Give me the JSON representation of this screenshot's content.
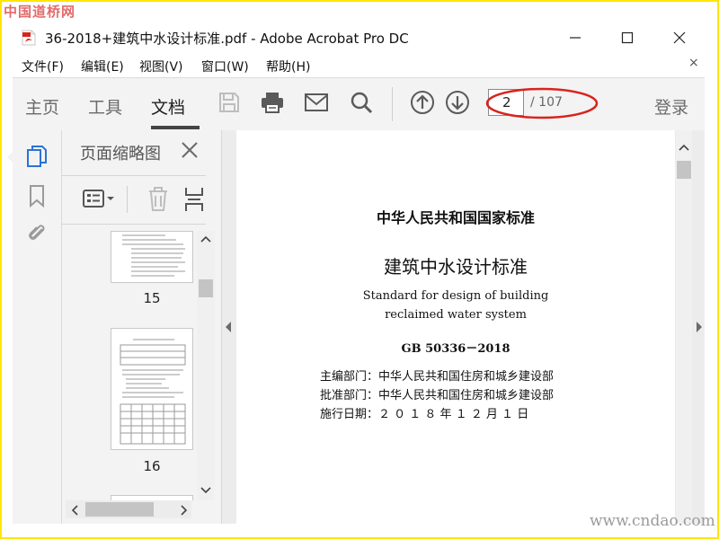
{
  "watermark_top": "中国道桥网",
  "watermark_bottom": "www.cndao.com",
  "window": {
    "title": "36-2018+建筑中水设计标准.pdf - Adobe Acrobat Pro DC"
  },
  "menu": {
    "items": [
      "文件(F)",
      "编辑(E)",
      "视图(V)",
      "窗口(W)",
      "帮助(H)"
    ],
    "close_glyph": "×"
  },
  "toolbar": {
    "tabs": [
      "主页",
      "工具",
      "文档"
    ],
    "active_tab": "文档",
    "icons": [
      "save-icon",
      "print-icon",
      "email-icon",
      "search-icon",
      "page-up-icon",
      "page-down-icon"
    ],
    "page_number": "2",
    "page_total": "/ 107",
    "login_label": "登录",
    "highlight_color": "#d9231d"
  },
  "left_rail": {
    "icons": [
      "page-thumbnails-icon",
      "bookmark-icon",
      "attachment-icon"
    ],
    "accent_color": "#2b72d6"
  },
  "thumbnail_panel": {
    "title": "页面缩略图",
    "thumbnails": [
      {
        "label": "15"
      },
      {
        "label": "16"
      }
    ]
  },
  "document": {
    "heading": "中华人民共和国国家标准",
    "title": "建筑中水设计标准",
    "english_title_line1": "Standard for design of building",
    "english_title_line2": "reclaimed water system",
    "code": "GB 50336－2018",
    "info": [
      "主编部门：中华人民共和国住房和城乡建设部",
      "批准部门：中华人民共和国住房和城乡建设部",
      "施行日期：２ ０ １ ８  年  １ ２  月  １  日"
    ]
  }
}
